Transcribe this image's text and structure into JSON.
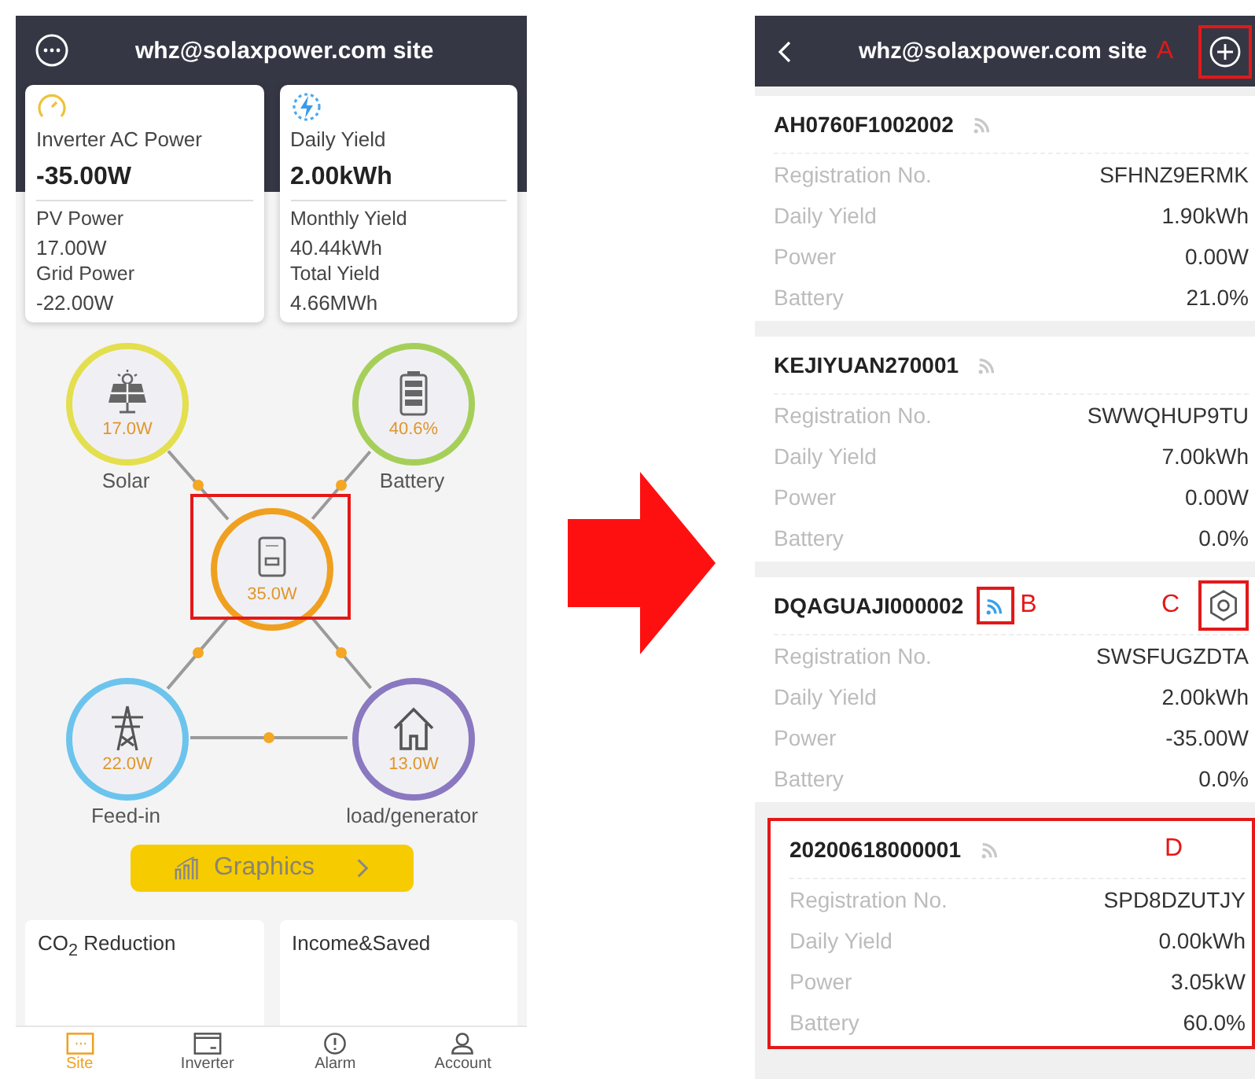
{
  "left_screen": {
    "title": "whz@solaxpower.com site",
    "cards": [
      {
        "kind": "gauge",
        "label": "Inverter AC Power",
        "value": "-35.00W",
        "details": [
          {
            "label": "PV Power",
            "value": "17.00W"
          },
          {
            "label": "Grid Power",
            "value": "-22.00W"
          }
        ]
      },
      {
        "kind": "energy",
        "label": "Daily Yield",
        "value": "2.00kWh",
        "details": [
          {
            "label": "Monthly Yield",
            "value": "40.44kWh"
          },
          {
            "label": "Total Yield",
            "value": "4.66MWh"
          }
        ]
      }
    ],
    "flow_nodes": [
      {
        "kind": "solar",
        "value": "17.0W",
        "label": "Solar",
        "color": "#e3df4e"
      },
      {
        "kind": "battery",
        "value": "40.6%",
        "label": "Battery",
        "color": "#a6cf5a"
      },
      {
        "kind": "inverter",
        "value": "35.0W",
        "color": "#f0a020",
        "highlighted": true
      },
      {
        "kind": "grid",
        "value": "22.0W",
        "label": "Feed-in",
        "color": "#6cc4ec"
      },
      {
        "kind": "load",
        "value": "13.0W",
        "label": "load/generator",
        "color": "#8a78c0"
      }
    ],
    "graphics_button": "Graphics",
    "summary_cards": [
      "CO$_{2}$ Reduction",
      "Income&Saved"
    ],
    "nav": [
      {
        "kind": "site",
        "label": "Site",
        "selected": true
      },
      {
        "kind": "inverter",
        "label": "Inverter",
        "selected": false
      },
      {
        "kind": "alarm",
        "label": "Alarm",
        "selected": false
      },
      {
        "kind": "account",
        "label": "Account",
        "selected": false
      }
    ]
  },
  "right_screen": {
    "title": "whz@solaxpower.com site",
    "add_annotation": "A",
    "devices": [
      {
        "name": "AH0760F1002002",
        "online": false,
        "rows": [
          {
            "label": "Registration No.",
            "value": "SFHNZ9ERMK"
          },
          {
            "label": "Daily Yield",
            "value": "1.90kWh"
          },
          {
            "label": "Power",
            "value": "0.00W"
          },
          {
            "label": "Battery",
            "value": "21.0%"
          }
        ]
      },
      {
        "name": "KEJIYUAN270001",
        "online": false,
        "rows": [
          {
            "label": "Registration No.",
            "value": "SWWQHUP9TU"
          },
          {
            "label": "Daily Yield",
            "value": "7.00kWh"
          },
          {
            "label": "Power",
            "value": "0.00W"
          },
          {
            "label": "Battery",
            "value": "0.0%"
          }
        ]
      },
      {
        "name": "DQAGUAJI000002",
        "online": true,
        "signal_annotation": "B",
        "settings_annotation": "C",
        "rows": [
          {
            "label": "Registration No.",
            "value": "SWSFUGZDTA"
          },
          {
            "label": "Daily Yield",
            "value": "2.00kWh"
          },
          {
            "label": "Power",
            "value": "-35.00W"
          },
          {
            "label": "Battery",
            "value": "0.0%"
          }
        ]
      },
      {
        "name": "20200618000001",
        "online": false,
        "card_annotation": "D",
        "rows": [
          {
            "label": "Registration No.",
            "value": "SPD8DZUTJY"
          },
          {
            "label": "Daily Yield",
            "value": "0.00kWh"
          },
          {
            "label": "Power",
            "value": "3.05kW"
          },
          {
            "label": "Battery",
            "value": "60.0%"
          }
        ]
      }
    ]
  }
}
